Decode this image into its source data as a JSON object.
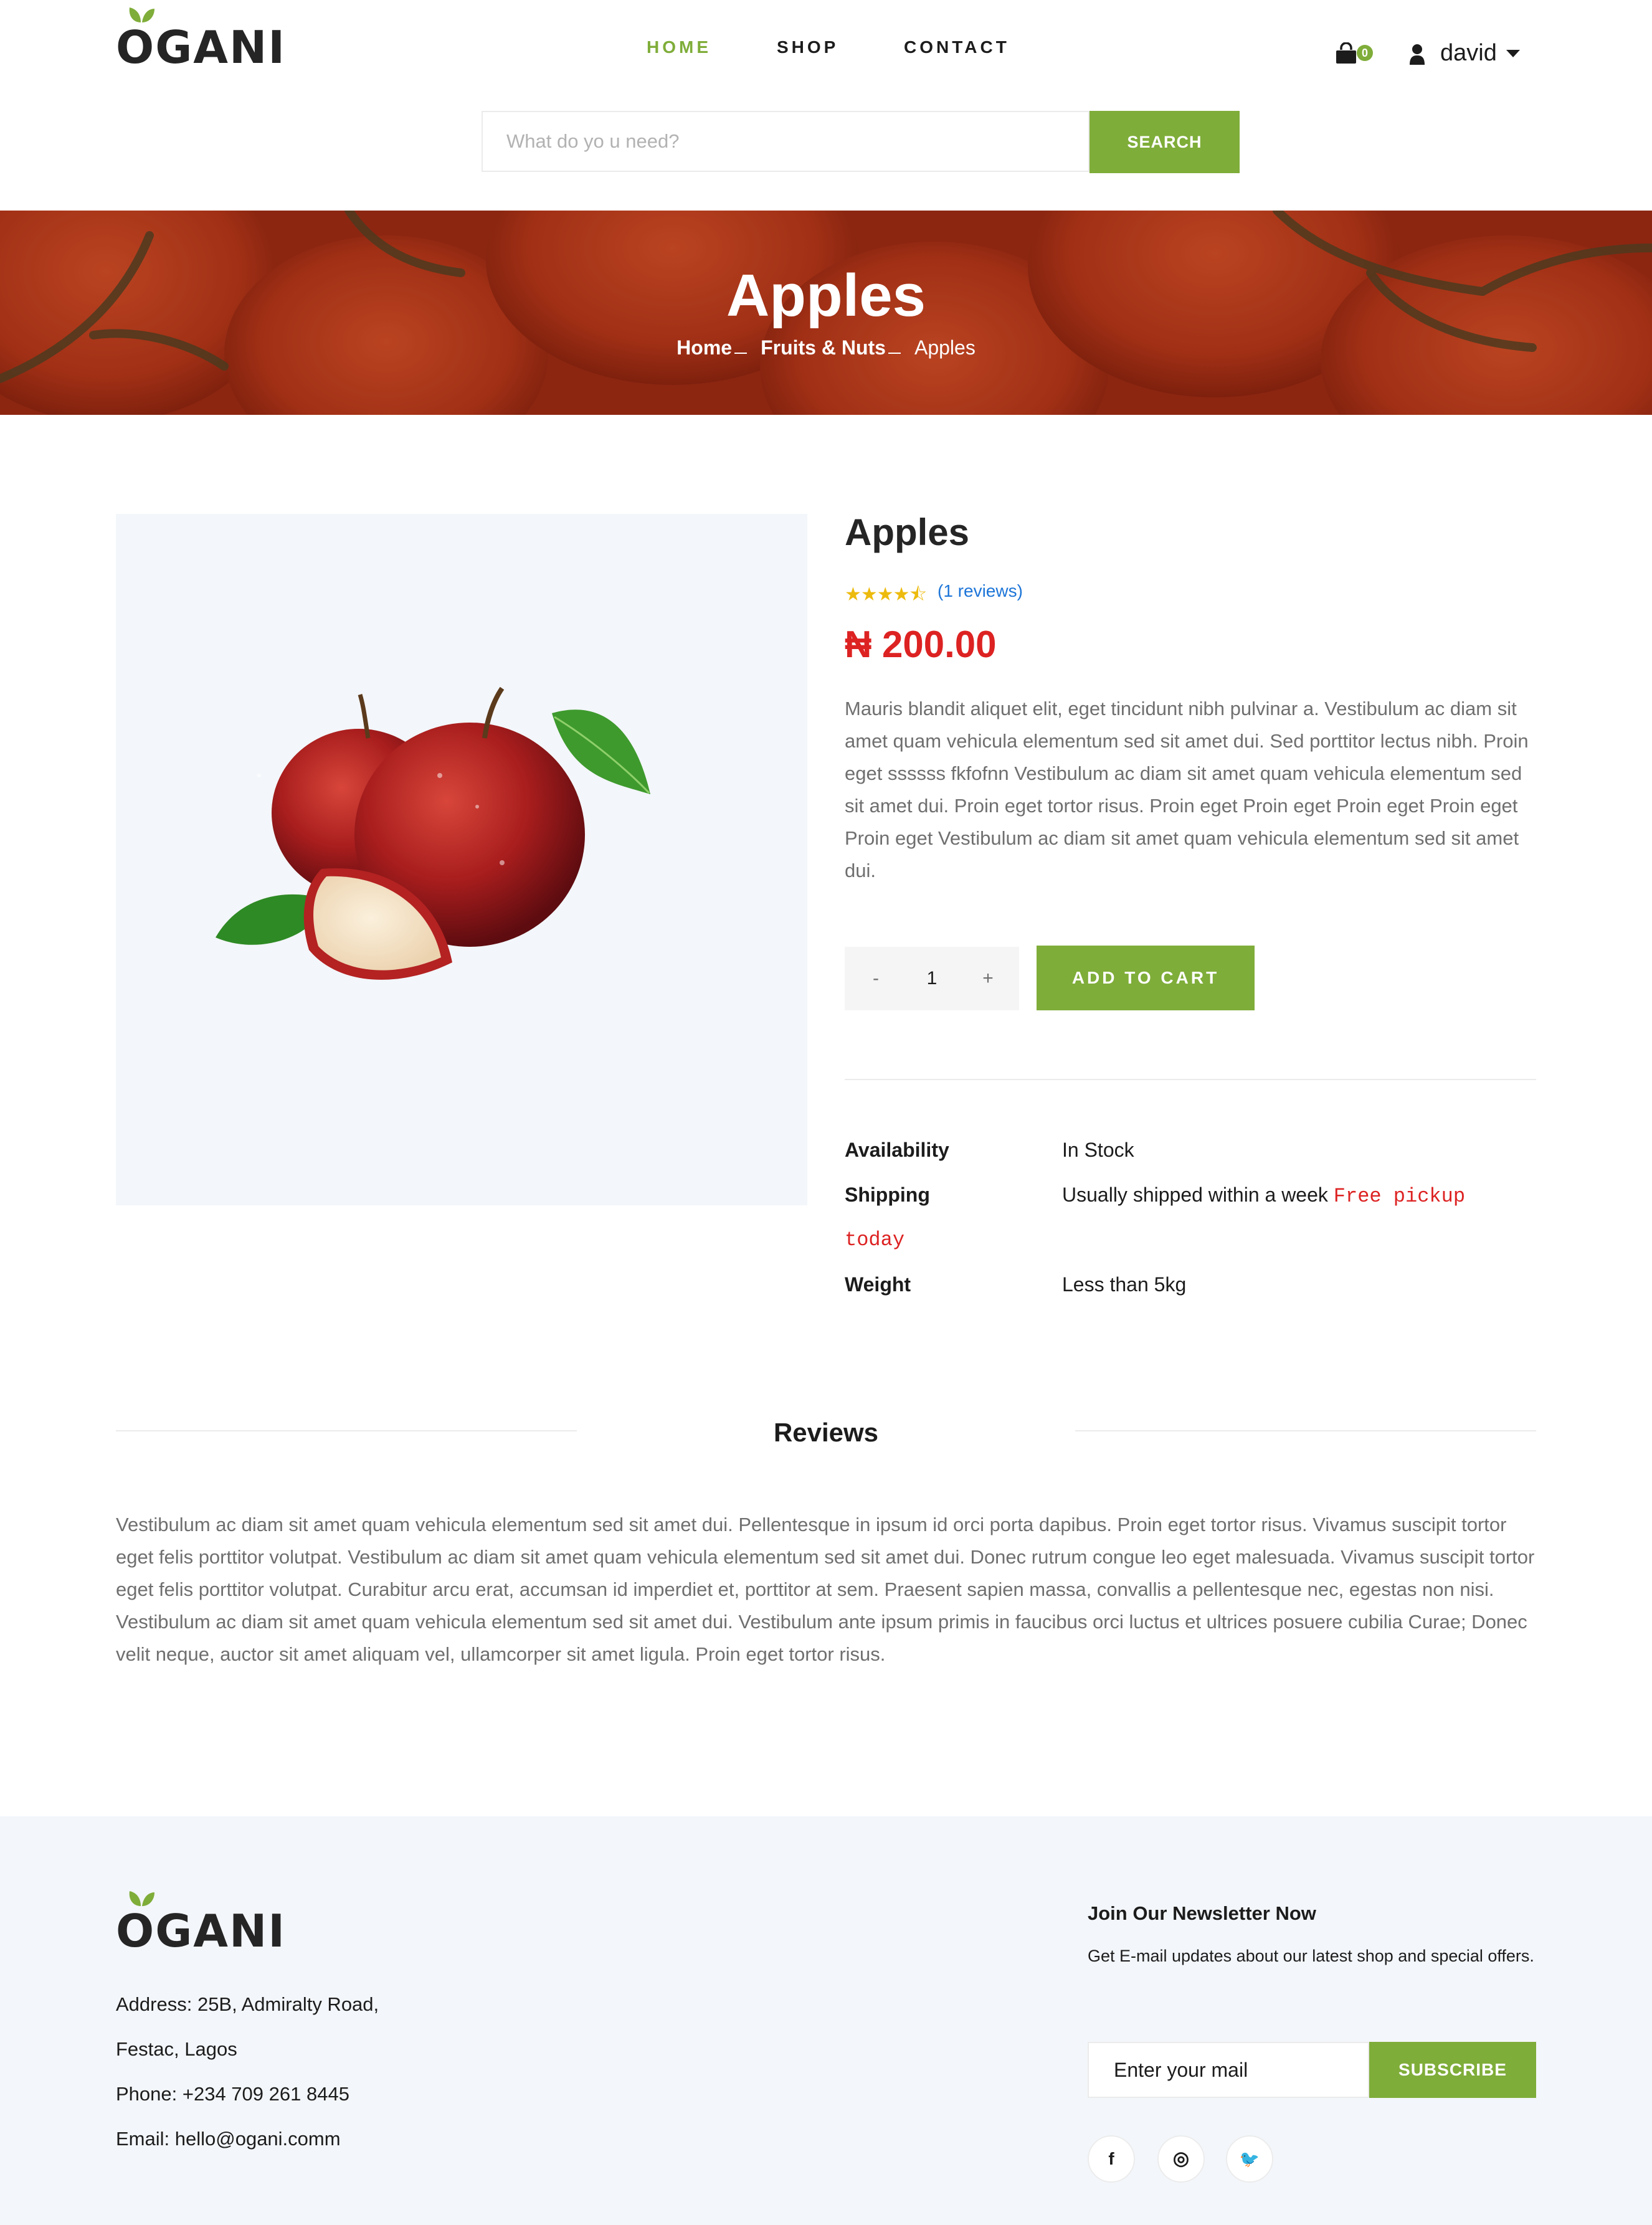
{
  "header": {
    "logo": "OGANI",
    "nav": [
      {
        "label": "HOME",
        "active": true
      },
      {
        "label": "SHOP",
        "active": false
      },
      {
        "label": "CONTACT",
        "active": false
      }
    ],
    "cart_count": "0",
    "user_name": "david",
    "search_placeholder": "What do yo u need?",
    "search_button": "SEARCH"
  },
  "banner": {
    "title": "Apples",
    "breadcrumb": [
      "Home",
      "Fruits & Nuts",
      "Apples"
    ]
  },
  "product": {
    "title": "Apples",
    "rating": 4.5,
    "stars_text": "★★★★⯪",
    "reviews_link": "(1 reviews)",
    "price": "₦ 200.00",
    "description": "Mauris blandit aliquet elit, eget tincidunt nibh pulvinar a. Vestibulum ac diam sit amet quam vehicula elementum sed sit amet dui. Sed porttitor lectus nibh. Proin eget ssssss fkfofnn Vestibulum ac diam sit amet quam vehicula elementum sed sit amet dui. Proin eget tortor risus. Proin eget Proin eget Proin eget Proin eget Proin eget Vestibulum ac diam sit amet quam vehicula elementum sed sit amet dui.",
    "quantity": {
      "minus": "-",
      "value": "1",
      "plus": "+"
    },
    "add_to_cart": "ADD TO CART",
    "info": {
      "availability_label": "Availability",
      "availability_value": "In Stock",
      "shipping_label": "Shipping",
      "shipping_value": "Usually shipped within a week",
      "shipping_note_1": "Free pickup",
      "shipping_note_2": "today",
      "weight_label": "Weight",
      "weight_value": "Less than 5kg"
    }
  },
  "reviews": {
    "title": "Reviews",
    "text": "Vestibulum ac diam sit amet quam vehicula elementum sed sit amet dui. Pellentesque in ipsum id orci porta dapibus. Proin eget tortor risus. Vivamus suscipit tortor eget felis porttitor volutpat. Vestibulum ac diam sit amet quam vehicula elementum sed sit amet dui. Donec rutrum congue leo eget malesuada. Vivamus suscipit tortor eget felis porttitor volutpat. Curabitur arcu erat, accumsan id imperdiet et, porttitor at sem. Praesent sapien massa, convallis a pellentesque nec, egestas non nisi. Vestibulum ac diam sit amet quam vehicula elementum sed sit amet dui. Vestibulum ante ipsum primis in faucibus orci luctus et ultrices posuere cubilia Curae; Donec velit neque, auctor sit amet aliquam vel, ullamcorper sit amet ligula. Proin eget tortor risus."
  },
  "footer": {
    "logo": "OGANI",
    "address_1": "Address: 25B, Admiralty Road,",
    "address_2": "Festac, Lagos",
    "phone": "Phone: +234 709 261 8445",
    "email": "Email: hello@ogani.comm",
    "newsletter_title": "Join Our Newsletter Now",
    "newsletter_text": "Get E-mail updates about our latest shop and special offers.",
    "newsletter_placeholder": "Enter your mail",
    "subscribe": "SUBSCRIBE",
    "social": [
      {
        "icon": "facebook-icon",
        "glyph": "f"
      },
      {
        "icon": "instagram-icon",
        "glyph": "◎"
      },
      {
        "icon": "twitter-icon",
        "glyph": "🐦"
      }
    ]
  },
  "colors": {
    "accent": "#7fad39",
    "price": "#dd2222",
    "link": "#1d75d8",
    "star": "#edbb0e",
    "banner": "#b3371a"
  }
}
